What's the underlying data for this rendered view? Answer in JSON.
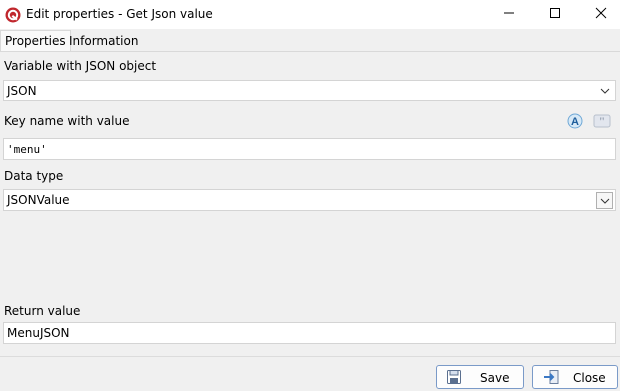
{
  "window": {
    "title": "Edit properties - Get Json value",
    "icon": "app-logo-icon",
    "controls": [
      "minimize-icon",
      "maximize-icon",
      "close-icon"
    ]
  },
  "tabs": [
    {
      "label": "Properties",
      "active": true
    },
    {
      "label": "Information",
      "active": false
    }
  ],
  "form": {
    "variable_label": "Variable with JSON object",
    "variable_value": "JSON",
    "key_label": "Key name with value",
    "key_value": "'menu'",
    "datatype_label": "Data type",
    "datatype_value": "JSONValue",
    "return_label": "Return value",
    "return_value": "MenuJSON"
  },
  "buttons": {
    "save": "Save",
    "close": "Close"
  },
  "colors": {
    "button_border": "#7a9ac8",
    "window_bg": "#f0f0f0",
    "app_icon": "#c0272d"
  }
}
